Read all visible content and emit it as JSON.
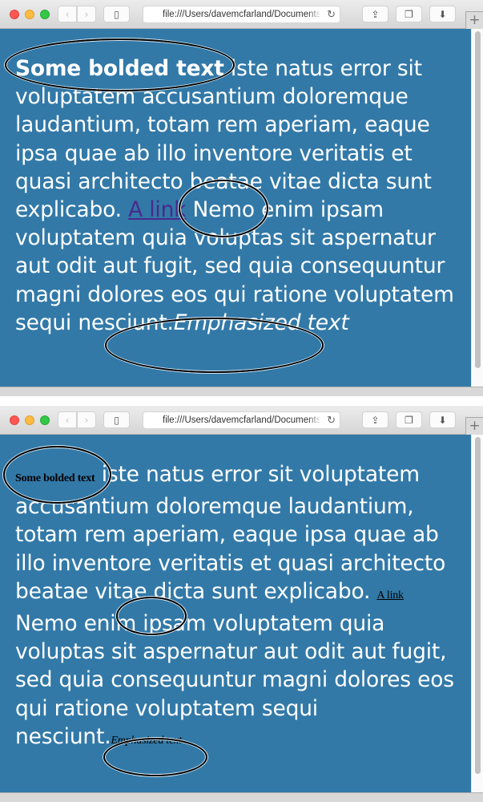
{
  "browser": {
    "url": "file:///Users/davemcfarland/Documents",
    "buttons": {
      "back": "back",
      "forward": "forward",
      "sidebar": "sidebar",
      "reload": "reload",
      "share": "share",
      "tabs": "tab overview",
      "downloads": "downloads",
      "new_tab": "+"
    },
    "icons": {
      "back": "‹",
      "forward": "›",
      "sidebar": "▯",
      "reload": "↻",
      "share": "⇪",
      "tabs": "❐",
      "downloads": "⬇",
      "new_tab": "+"
    }
  },
  "windows": [
    {
      "label": "styled",
      "bold": "Some bolded text",
      "text1": " iste natus error sit voluptatem accusantium doloremque laudantium, totam rem aperiam, eaque ipsa quae ab illo inventore veritatis et quasi architecto beatae vitae dicta sunt explicabo. ",
      "link": "A link",
      "text2": " Nemo enim ipsam voluptatem quia voluptas sit aspernatur aut odit aut fugit, sed quia consequuntur magni dolores eos qui ratione voluptatem sequi nesciunt.",
      "emphasized": "Emphasized text"
    },
    {
      "label": "unstyled-inline",
      "bold": "Some bolded text",
      "text1": " iste natus error sit voluptatem accusantium doloremque laudantium, totam rem aperiam, eaque ipsa quae ab illo inventore veritatis et quasi architecto beatae vitae dicta sunt explicabo. ",
      "link": "A link",
      "text2": " Nemo enim ipsam voluptatem quia voluptas sit aspernatur aut odit aut fugit, sed quia consequuntur magni dolores eos qui ratione voluptatem sequi nesciunt.",
      "emphasized": "Emphasized text"
    }
  ],
  "colors": {
    "page_background": "#3279a8",
    "body_text": "#ffffff",
    "link_visited": "#4a2a8c",
    "annotation_ellipse": "#000000"
  }
}
